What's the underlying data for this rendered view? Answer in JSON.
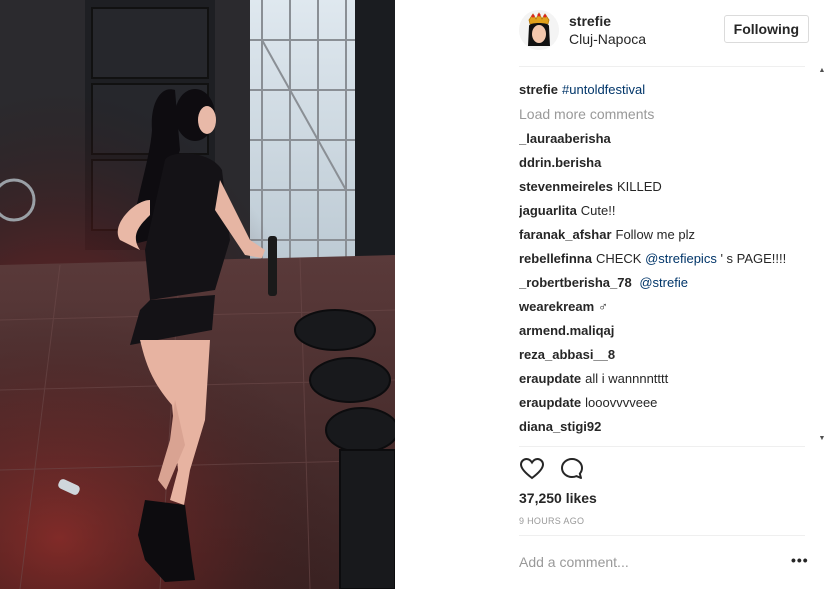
{
  "post": {
    "username": "strefie",
    "location": "Cluj-Napoca",
    "follow_button": "Following",
    "likes": "37,250 likes",
    "time": "9 HOURS AGO",
    "add_comment_placeholder": "Add a comment...",
    "more_options": "•••"
  },
  "caption": {
    "author": "strefie",
    "prefix": "",
    "hashtag": "#untoldfestival",
    "suffix": ""
  },
  "load_more": "Load more comments",
  "comments": [
    {
      "author": "_lauraaberisha",
      "text": ""
    },
    {
      "author": "ddrin.berisha",
      "text": ""
    },
    {
      "author": "stevenmeireles",
      "text": "KILLED "
    },
    {
      "author": "jaguarlita",
      "text": "Cute!!"
    },
    {
      "author": "faranak_afshar",
      "text": "Follow me plz "
    },
    {
      "author": "rebellefinna",
      "text": "CHECK",
      "mention": "@strefiepics",
      "after": " ' s PAGE!!!!"
    },
    {
      "author": "_robertberisha_78",
      "text": "",
      "mention": "@strefie"
    },
    {
      "author": "wearekream",
      "text": "‍♂"
    },
    {
      "author": "armend.maliqaj",
      "text": ""
    },
    {
      "author": "reza_abbasi__8",
      "text": ""
    },
    {
      "author": "eraupdate",
      "text": "all i wannnntttt"
    },
    {
      "author": "eraupdate",
      "text": "looovvvveee"
    },
    {
      "author": "diana_stigi92",
      "text": ""
    }
  ],
  "icons": {
    "heart": "heart-outline",
    "comment": "speech-bubble-outline"
  },
  "colors": {
    "link": "#003569",
    "muted": "#999999",
    "text": "#262626",
    "border": "#dbdbdb"
  }
}
